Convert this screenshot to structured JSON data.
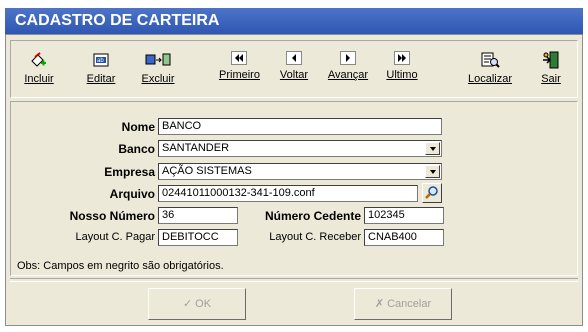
{
  "window": {
    "title": "CADASTRO DE CARTEIRA"
  },
  "toolbar": {
    "incluir": "Incluir",
    "editar": "Editar",
    "excluir": "Excluir",
    "primeiro": "Primeiro",
    "voltar": "Voltar",
    "avancar": "Avançar",
    "ultimo": "Ultimo",
    "localizar": "Localizar",
    "sair": "Sair"
  },
  "form": {
    "nome_label": "Nome",
    "nome_value": "BANCO",
    "banco_label": "Banco",
    "banco_value": "SANTANDER",
    "empresa_label": "Empresa",
    "empresa_value": "AÇÃO SISTEMAS",
    "arquivo_label": "Arquivo",
    "arquivo_value": "02441011000132-341-109.conf",
    "nosso_numero_label": "Nosso Número",
    "nosso_numero_value": "36",
    "numero_cedente_label": "Número Cedente",
    "numero_cedente_value": "102345",
    "layout_pagar_label": "Layout C. Pagar",
    "layout_pagar_value": "DEBITOCC",
    "layout_receber_label": "Layout C. Receber",
    "layout_receber_value": "CNAB400"
  },
  "obs": "Obs: Campos em negrito são obrigatórios.",
  "buttons": {
    "ok": "OK",
    "cancelar": "Cancelar"
  }
}
